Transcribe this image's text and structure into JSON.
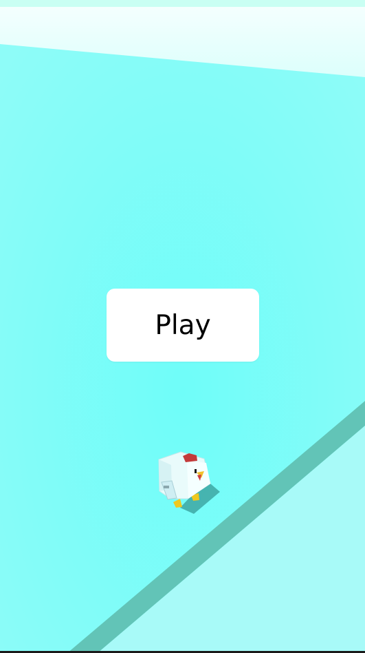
{
  "game": {
    "play_button_label": "Play",
    "character": "chicken"
  },
  "colors": {
    "ground": "#78fcf9",
    "edge": "#62c4b7",
    "platform": "#a8faf8",
    "sky": "#edfffd",
    "button_bg": "#ffffff",
    "button_text": "#000000"
  }
}
